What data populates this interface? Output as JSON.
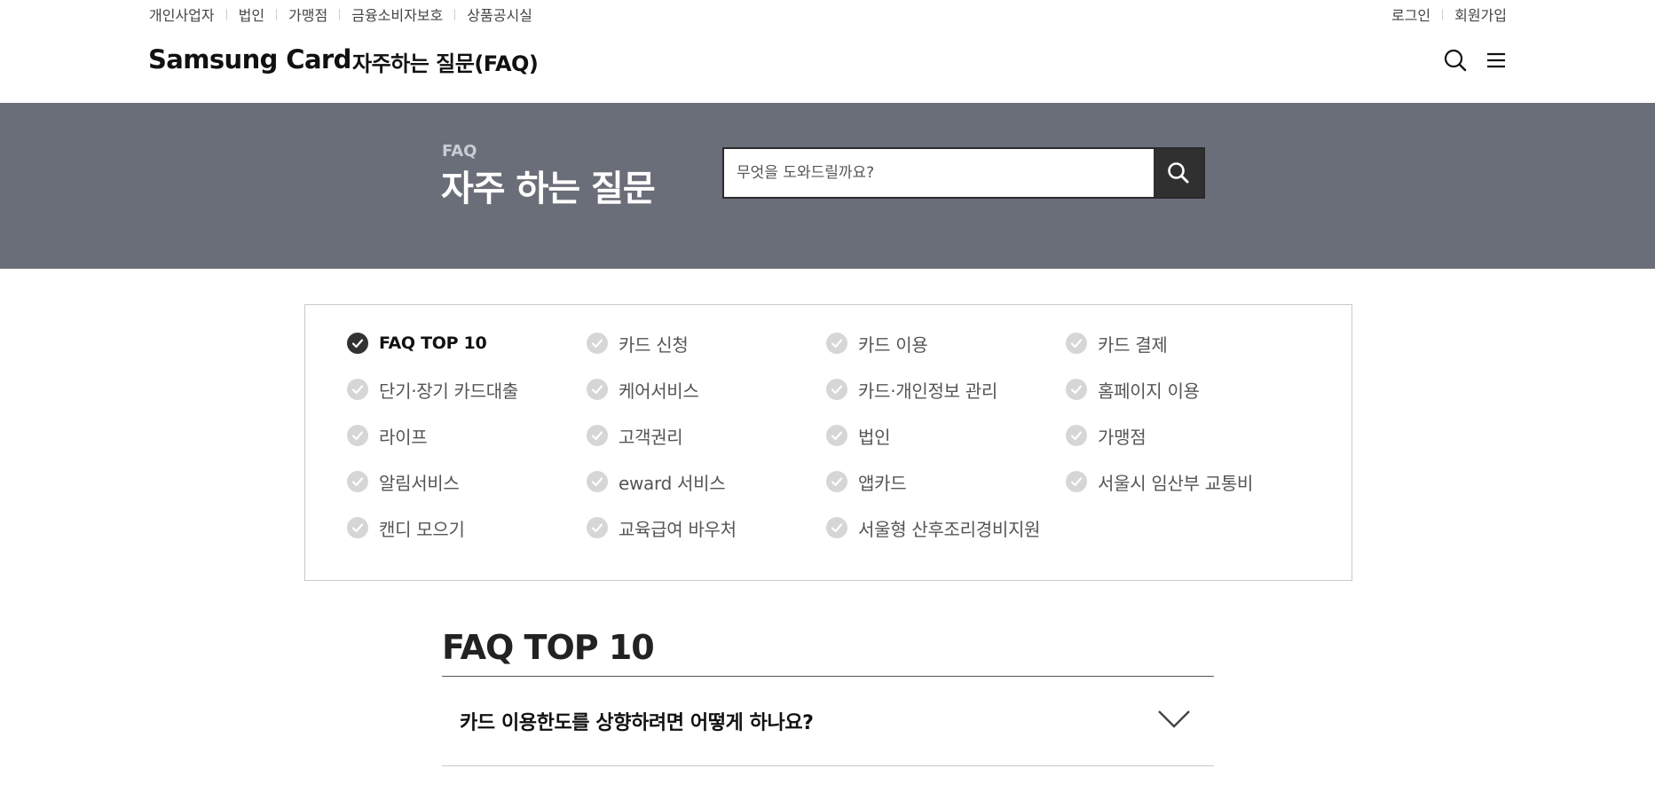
{
  "util_nav": {
    "left": [
      "개인사업자",
      "법인",
      "가맹점",
      "금융소비자보호",
      "상품공시실"
    ],
    "right": [
      "로그인",
      "회원가입"
    ]
  },
  "header": {
    "logo": "Samsung Card",
    "page_name": "자주하는 질문(FAQ)",
    "icons": [
      "search-icon",
      "menu-icon"
    ]
  },
  "banner": {
    "eyebrow": "FAQ",
    "title": "자주 하는 질문",
    "bg_color": "#6a6e78",
    "search_placeholder": "무엇을 도와드릴까요?"
  },
  "categories": [
    {
      "label": "FAQ TOP 10",
      "active": true
    },
    {
      "label": "카드 신청",
      "active": false
    },
    {
      "label": "카드 이용",
      "active": false
    },
    {
      "label": "카드 결제",
      "active": false
    },
    {
      "label": "단기·장기 카드대출",
      "active": false
    },
    {
      "label": "케어서비스",
      "active": false
    },
    {
      "label": "카드·개인정보 관리",
      "active": false
    },
    {
      "label": "홈페이지 이용",
      "active": false
    },
    {
      "label": "라이프",
      "active": false
    },
    {
      "label": "고객권리",
      "active": false
    },
    {
      "label": "법인",
      "active": false
    },
    {
      "label": "가맹점",
      "active": false
    },
    {
      "label": "알림서비스",
      "active": false
    },
    {
      "label": "eward 서비스",
      "active": false
    },
    {
      "label": "앱카드",
      "active": false
    },
    {
      "label": "서울시 임산부 교통비",
      "active": false
    },
    {
      "label": "캔디 모으기",
      "active": false
    },
    {
      "label": "교육급여 바우처",
      "active": false
    },
    {
      "label": "서울형 산후조리경비지원",
      "active": false
    }
  ],
  "faq": {
    "title": "FAQ TOP 10",
    "items": [
      {
        "question": "카드 이용한도를 상향하려면 어떻게 하나요?"
      }
    ]
  }
}
